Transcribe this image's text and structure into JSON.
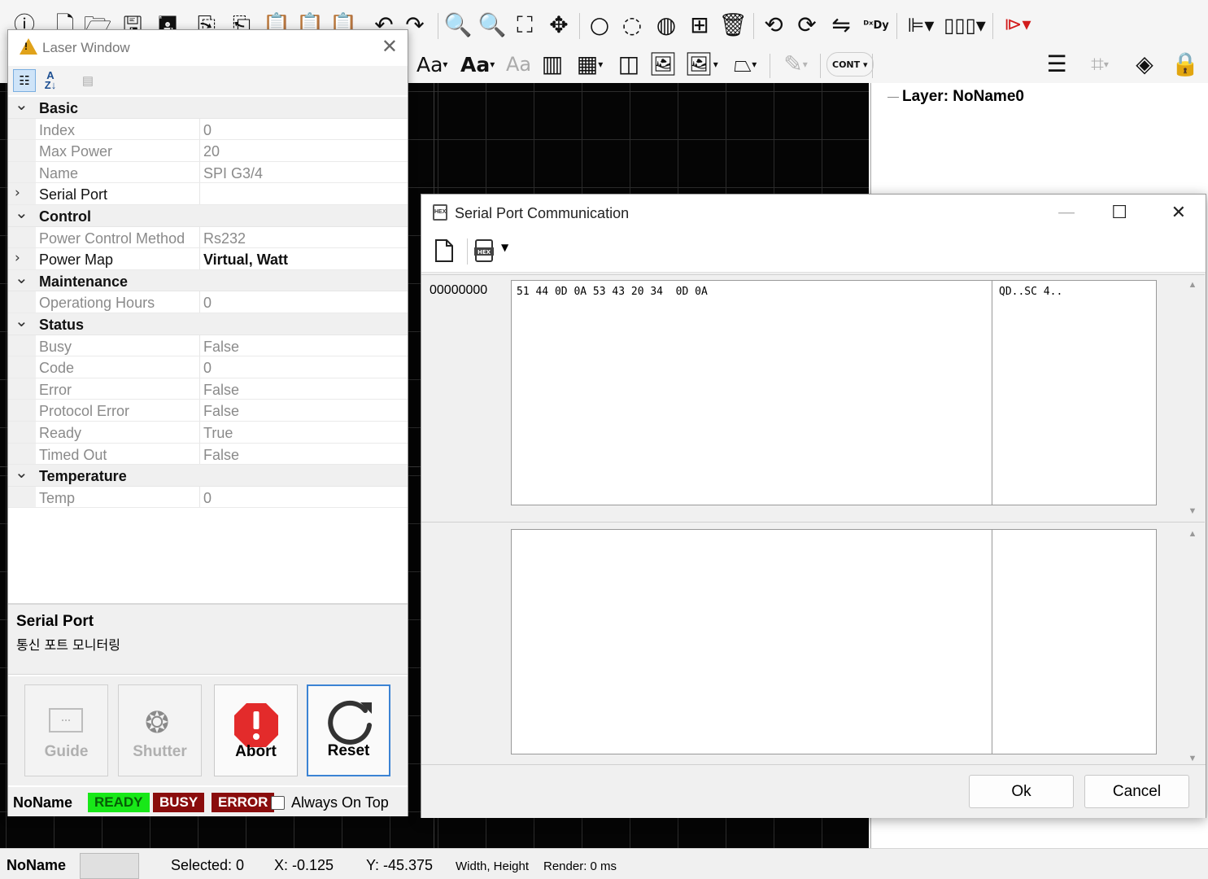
{
  "toolbar": {
    "row1_icons": [
      "info-icon",
      "new-file-icon",
      "open-folder-icon",
      "save-icon",
      "save-as-icon",
      "copy-icon",
      "paste-icon",
      "clipboard-icon",
      "clipboard-special-icon",
      "clipboard-list-icon",
      "undo-icon",
      "redo-icon",
      "zoom-out-icon",
      "zoom-in-icon",
      "zoom-fit-icon",
      "pan-icon",
      "circle-icon",
      "arc-icon",
      "hatch-icon",
      "group-icon",
      "delete-icon",
      "rotate-ccw-icon",
      "rotate-cw-icon",
      "mirror-icon",
      "dxdy-icon",
      "align-left-icon",
      "distribute-icon",
      "run-icon"
    ],
    "font_aa_regular": "Aa",
    "font_aa_bold": "Aa",
    "font_aa_light": "Aa",
    "cont_label": "CONT"
  },
  "layer_panel": {
    "layer_label": "Layer: NoName0"
  },
  "statusbar": {
    "name": "NoName",
    "selected": "Selected: 0",
    "x": "X: -0.125",
    "y": "Y: -45.375",
    "width_height": "Width, Height",
    "render": "Render: 0 ms"
  },
  "laser_window": {
    "title": "Laser Window",
    "properties": [
      {
        "kind": "category",
        "name": "Basic",
        "expanded": true
      },
      {
        "kind": "prop",
        "name": "Index",
        "value": "0"
      },
      {
        "kind": "prop",
        "name": "Max Power",
        "value": "20"
      },
      {
        "kind": "prop",
        "name": "Name",
        "value": "SPI G3/4"
      },
      {
        "kind": "expandable",
        "name": "Serial Port",
        "value": ""
      },
      {
        "kind": "category",
        "name": "Control",
        "expanded": true
      },
      {
        "kind": "prop",
        "name": "Power Control Method",
        "value": "Rs232"
      },
      {
        "kind": "expandable",
        "name": "Power Map",
        "value": "Virtual, Watt"
      },
      {
        "kind": "category",
        "name": "Maintenance",
        "expanded": true
      },
      {
        "kind": "prop",
        "name": "Operationg Hours",
        "value": "0"
      },
      {
        "kind": "category",
        "name": "Status",
        "expanded": true
      },
      {
        "kind": "prop",
        "name": "Busy",
        "value": "False"
      },
      {
        "kind": "prop",
        "name": "Code",
        "value": "0"
      },
      {
        "kind": "prop",
        "name": "Error",
        "value": "False"
      },
      {
        "kind": "prop",
        "name": "Protocol Error",
        "value": "False"
      },
      {
        "kind": "prop",
        "name": "Ready",
        "value": "True"
      },
      {
        "kind": "prop",
        "name": "Timed Out",
        "value": "False"
      },
      {
        "kind": "category",
        "name": "Temperature",
        "expanded": true
      },
      {
        "kind": "prop",
        "name": "Temp",
        "value": "0"
      }
    ],
    "description": {
      "title": "Serial Port",
      "text": "통신 포트 모니터링"
    },
    "buttons": {
      "guide": "Guide",
      "shutter": "Shutter",
      "abort": "Abort",
      "reset": "Reset"
    },
    "status_row": {
      "name": "NoName",
      "ready": "READY",
      "busy": "BUSY",
      "error": "ERROR",
      "always_on_top": "Always On Top"
    }
  },
  "serial_dialog": {
    "title": "Serial Port Communication",
    "tx_pane": {
      "address": "00000000",
      "hex": "51 44 0D 0A 53 43 20 34  0D 0A",
      "ascii": "QD..SC 4.."
    },
    "rx_pane": {
      "address": "",
      "hex": "",
      "ascii": ""
    },
    "ok_label": "Ok",
    "cancel_label": "Cancel"
  },
  "colors": {
    "ready_bg": "#18e818",
    "busy_bg": "#8a0d0d",
    "error_bg": "#8a0d0d",
    "abort_red": "#e32b2b",
    "reset_border": "#3b83d4",
    "canvas_bg": "#050505"
  }
}
